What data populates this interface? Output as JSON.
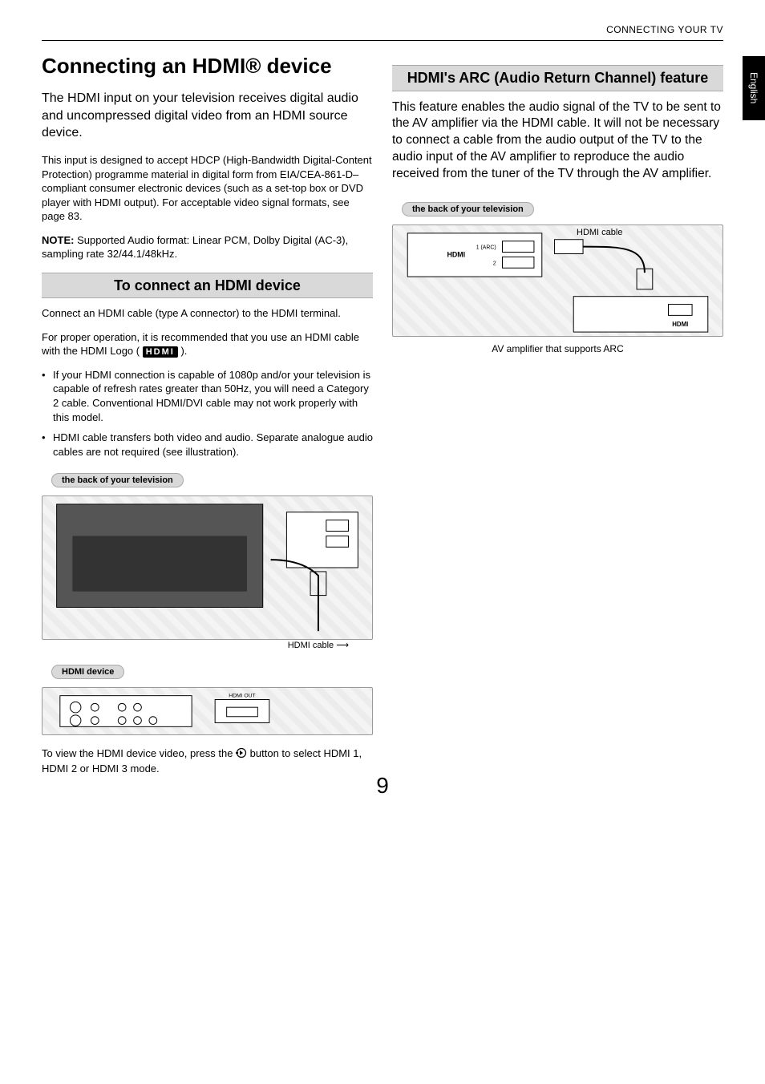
{
  "header": {
    "category": "CONNECTING YOUR TV",
    "side_tab": "English"
  },
  "left": {
    "h1": "Connecting an HDMI® device",
    "intro": "The HDMI input on your television receives digital audio and uncompressed digital video from an HDMI source device.",
    "body1": "This input is designed to accept HDCP (High-Bandwidth Digital-Content Protection) programme material in digital form from EIA/CEA-861-D–compliant consumer electronic devices (such as a set-top box or DVD player with HDMI output). For acceptable video signal formats, see page 83.",
    "note_label": "NOTE:",
    "note_body": " Supported Audio format: Linear PCM, Dolby Digital (AC-3), sampling rate 32/44.1/48kHz.",
    "subhead": "To connect an HDMI device",
    "body2": "Connect an HDMI cable (type A connector) to the HDMI terminal.",
    "body3_a": "For proper operation, it is recommended that you use an HDMI cable with the HDMI Logo ( ",
    "body3_logo": "HDMI",
    "body3_b": " ).",
    "bullet1": "If your HDMI connection is capable of 1080p and/or your television is capable of refresh rates greater than 50Hz, you will need a Category 2 cable. Conventional HDMI/DVI cable may not work properly with this model.",
    "bullet2": "HDMI cable transfers both video and audio. Separate analogue audio cables are not required (see illustration).",
    "pill_tv": "the back of your television",
    "diagram_hdmi_cable": "HDMI cable",
    "pill_device": "HDMI device",
    "body4_a": "To view the HDMI device video, press the ",
    "body4_b": " button to select HDMI 1, HDMI 2 or HDMI 3 mode."
  },
  "right": {
    "subhead": "HDMI's ARC (Audio Return Channel) feature",
    "intro": "This feature enables the audio signal of the TV to be sent to the AV amplifier via the HDMI cable. It will not be necessary to connect a cable from the audio output of the TV to the audio input of the AV amplifier to reproduce the audio received from the tuner of the TV through the AV amplifier.",
    "pill_tv": "the back of your television",
    "diagram_hdmi_cable": "HDMI cable",
    "caption": "AV amplifier that supports ARC"
  },
  "page_number": "9"
}
